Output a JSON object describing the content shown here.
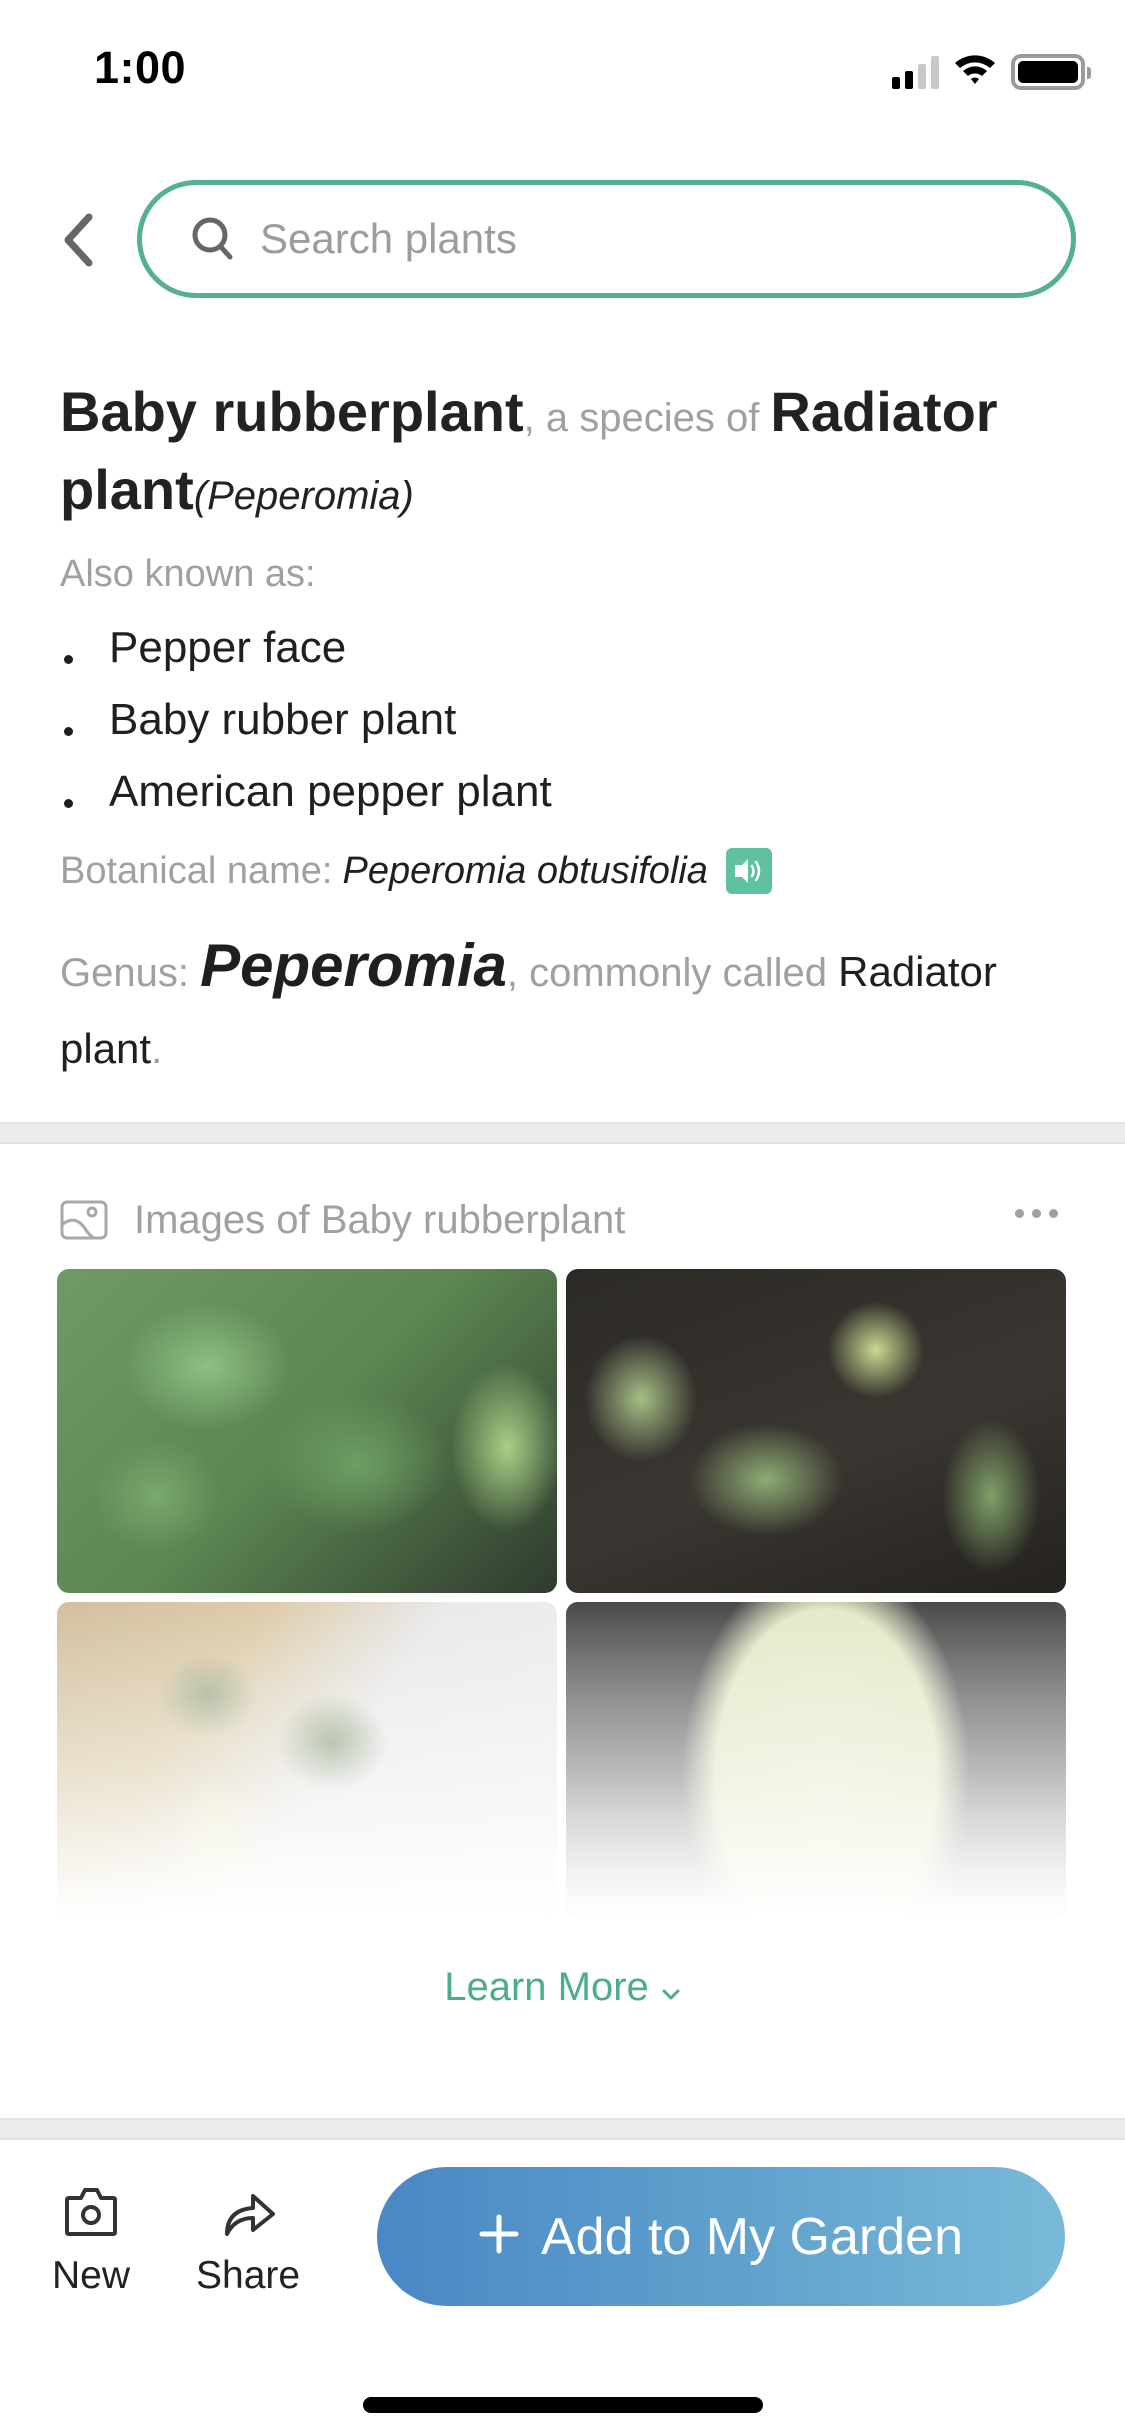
{
  "status_bar": {
    "time": "1:00",
    "signal_bars_active": 2,
    "signal_bars_total": 4,
    "wifi": "wifi-icon",
    "battery_level": 1.0
  },
  "header": {
    "back_icon": "chevron-left-icon",
    "search": {
      "value": "",
      "placeholder": "Search plants",
      "icon": "search-icon"
    }
  },
  "plant": {
    "common_name": "Baby rubberplant",
    "species_connector": ", a species of ",
    "genus_common_name": "Radiator plant",
    "genus_paren": "(Peperomia)",
    "also_known_as_label": "Also known as:",
    "also_known_as": [
      "Pepper face",
      "Baby rubber plant",
      "American pepper plant"
    ],
    "botanical_label": "Botanical name:",
    "botanical_name": "Peperomia obtusifolia",
    "pronounce_icon": "speaker-icon",
    "genus_label": "Genus:",
    "genus_name": "Peperomia",
    "genus_connector": ", commonly called ",
    "genus_called": "Radiator plant",
    "genus_end": "."
  },
  "images": {
    "icon": "image-gallery-icon",
    "title": "Images of Baby rubberplant",
    "more_icon": "more-horizontal-icon",
    "items": [
      {
        "alt": "Baby rubberplant photo 1"
      },
      {
        "alt": "Baby rubberplant photo 2"
      },
      {
        "alt": "Baby rubberplant photo 3"
      },
      {
        "alt": "Baby rubberplant photo 4"
      }
    ],
    "learn_more_label": "Learn More"
  },
  "bottom_bar": {
    "new_label": "New",
    "share_label": "Share",
    "add_label": "Add to My Garden",
    "accent_gradient": [
      "#4a87c6",
      "#79b9d8"
    ]
  },
  "colors": {
    "accent_green": "#55b08c",
    "speaker_green": "#5fc19d",
    "muted_text": "#a0a0a0"
  }
}
